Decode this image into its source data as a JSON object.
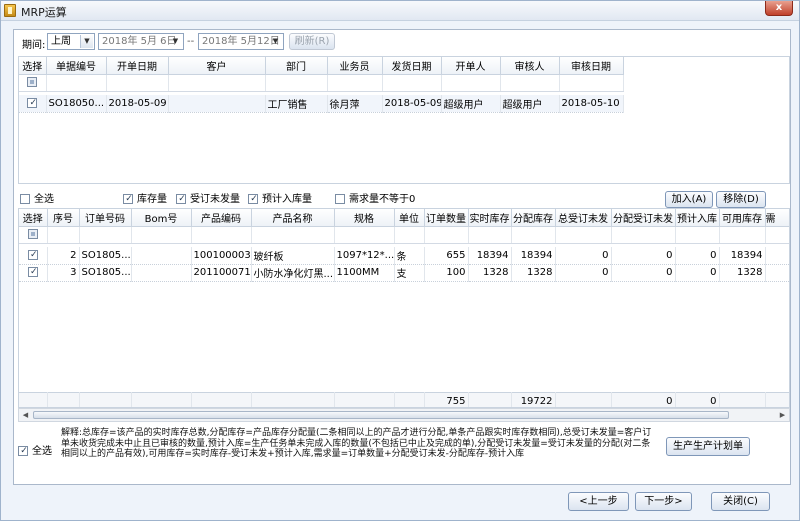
{
  "window": {
    "title": "MRP运算",
    "close_symbol": "x"
  },
  "filter": {
    "period_label": "期间:",
    "period_value": "上周",
    "date_from": "2018年 5月 6日",
    "separator": "--",
    "date_to": "2018年 5月12日",
    "refresh_label": "刷新(R)"
  },
  "orders": {
    "columns": [
      "选择",
      "单据编号",
      "开单日期",
      "客户",
      "部门",
      "业务员",
      "发货日期",
      "开单人",
      "审核人",
      "审核日期"
    ],
    "rows": [
      {
        "selected": true,
        "order_no": "SO18050...",
        "order_date": "2018-05-09",
        "customer": "",
        "dept": "工厂销售",
        "salesman": "徐月萍",
        "ship_date": "2018-05-09",
        "creator": "超级用户",
        "reviewer": "超级用户",
        "review_date": "2018-05-10"
      }
    ]
  },
  "options": {
    "select_all": "全选",
    "stock_qty": "库存量",
    "order_unshipped": "受订未发量",
    "expected_in": "预计入库量",
    "demand_not_equal_zero": "需求量不等于0",
    "add_label": "加入(A)",
    "remove_label": "移除(D)"
  },
  "products": {
    "columns": [
      "选择",
      "序号",
      "订单号码",
      "Bom号",
      "产品编码",
      "产品名称",
      "规格",
      "单位",
      "订单数量",
      "实时库存",
      "分配库存",
      "总受订未发",
      "分配受订未发",
      "预计入库",
      "可用库存",
      "需"
    ],
    "rows": [
      {
        "selected": true,
        "seq": "2",
        "order_no": "SO1805...",
        "bom": "",
        "code": "100100003",
        "name": "玻纤板",
        "spec": "1097*12*...",
        "unit": "条",
        "qty": "655",
        "stock": "18394",
        "alloc_stock": "18394",
        "unshipped": "0",
        "alloc_unshipped": "0",
        "expected_in": "0",
        "available": "18394"
      },
      {
        "selected": true,
        "seq": "3",
        "order_no": "SO1805...",
        "bom": "",
        "code": "201100071",
        "name": "小防水净化灯黑...",
        "spec": "1100MM",
        "unit": "支",
        "qty": "100",
        "stock": "1328",
        "alloc_stock": "1328",
        "unshipped": "0",
        "alloc_unshipped": "0",
        "expected_in": "0",
        "available": "1328"
      }
    ],
    "totals": {
      "qty": "755",
      "alloc_stock": "19722",
      "alloc_unshipped": "0",
      "expected_in": "0"
    }
  },
  "bottom": {
    "select_all": "全选",
    "note": "解释:总库存=该产品的实时库存总数,分配库存=产品库存分配量(二条相同以上的产品才进行分配,单条产品跟实时库存数相同),总受订未发量=客户订单未收货完成未中止且已审核的数量,预计入库=生产任务单未完成入库的数量(不包括已中止及完成的单),分配受订未发量=受订未发量的分配(对二条相同以上的产品有效),可用库存=实时库存-受订未发+预计入库,需求量=订单数量+分配受订未发-分配库存-预计入库",
    "generate_plan": "生产生产计划单",
    "prev": "<上一步",
    "next": "下一步>",
    "close": "关闭(C)"
  }
}
